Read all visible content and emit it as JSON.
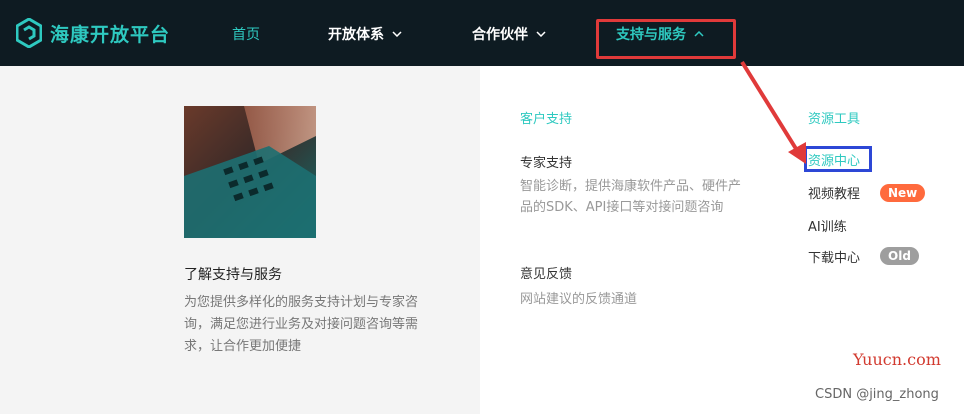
{
  "brand": {
    "name": "海康开放平台",
    "accent": "#2ec9c0"
  },
  "nav": {
    "home": "首页",
    "open_system": "开放体系",
    "partners": "合作伙伴",
    "support": "支持与服务"
  },
  "left": {
    "title": "了解支持与服务",
    "description": "为您提供多样化的服务支持计划与专家咨询，满足您进行业务及对接问题咨询等需求，让合作更加便捷"
  },
  "support_column": {
    "heading": "客户支持",
    "items": [
      {
        "title": "专家支持",
        "description": "智能诊断，提供海康软件产品、硬件产品的SDK、API接口等对接问题咨询"
      },
      {
        "title": "意见反馈",
        "description": "网站建议的反馈通道"
      }
    ]
  },
  "tools_column": {
    "heading": "资源工具",
    "items": [
      {
        "label": "资源中心"
      },
      {
        "label": "视频教程",
        "badge": "New"
      },
      {
        "label": "AI训练"
      },
      {
        "label": "下载中心",
        "badge": "Old"
      }
    ]
  },
  "watermarks": {
    "site": "Yuucn.com",
    "author": "CSDN @jing_zhong"
  }
}
